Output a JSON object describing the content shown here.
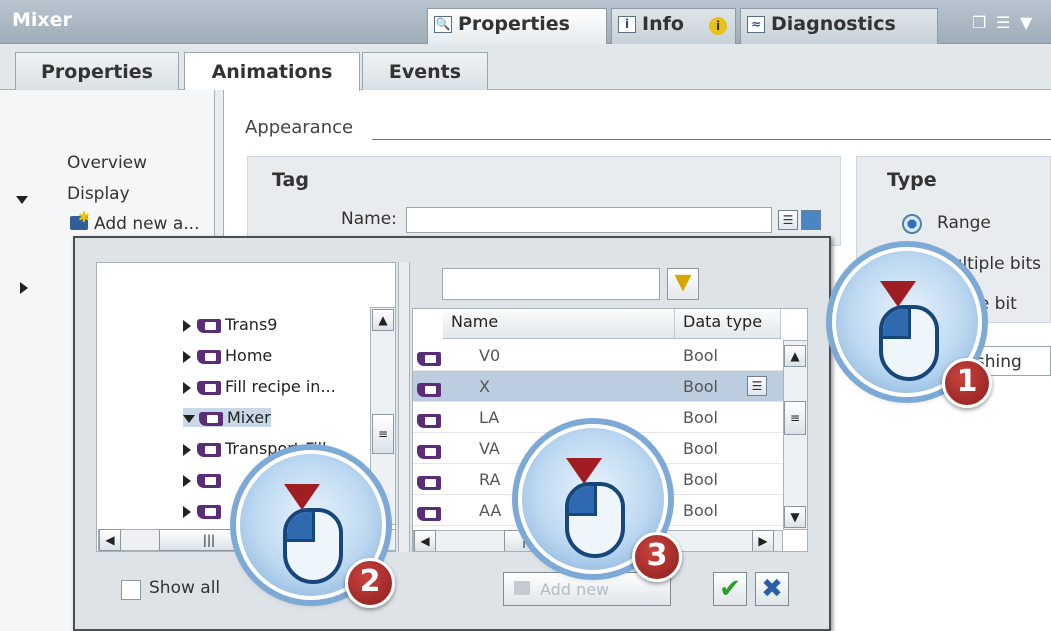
{
  "window": {
    "title": "Mixer"
  },
  "top_tabs": [
    {
      "label": "Properties",
      "icon": "properties-icon"
    },
    {
      "label": "Info",
      "icon": "info-icon"
    },
    {
      "label": "Diagnostics",
      "icon": "diagnostics-icon"
    }
  ],
  "sub_tabs": [
    "Properties",
    "Animations",
    "Events"
  ],
  "nav": {
    "overview": "Overview",
    "display": "Display",
    "add_new": "Add new a..."
  },
  "section": "Appearance",
  "tag_group": {
    "title": "Tag",
    "name_label": "Name:",
    "name_value": ""
  },
  "type_group": {
    "title": "Type",
    "options": [
      "Range",
      "Multiple bits",
      "Single bit"
    ],
    "selected": "Range"
  },
  "flashing_label": "Flashing",
  "dialog": {
    "filter_value": "",
    "tree": [
      "Trans9",
      "Home",
      "Fill recipe in...",
      "Mixer",
      "Transport Fill...",
      "",
      ""
    ],
    "selected_tree": "Mixer",
    "columns": [
      "Name",
      "Data type"
    ],
    "rows": [
      {
        "name": "V0",
        "type": "Bool"
      },
      {
        "name": "X",
        "type": "Bool"
      },
      {
        "name": "LA",
        "type": "Bool"
      },
      {
        "name": "VA",
        "type": "Bool"
      },
      {
        "name": "RA",
        "type": "Bool"
      },
      {
        "name": "AA",
        "type": "Bool"
      }
    ],
    "selected_row": "X",
    "show_all": "Show all",
    "add_new": "Add new",
    "ok_icon": "checkmark-icon",
    "cancel_icon": "cross-icon"
  },
  "callouts": [
    "1",
    "2",
    "3"
  ]
}
